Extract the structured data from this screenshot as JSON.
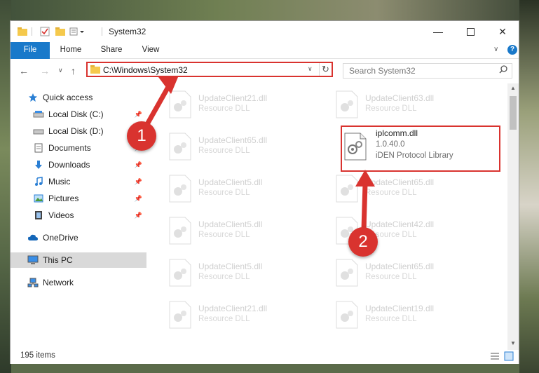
{
  "window": {
    "title": "System32",
    "minimize_icon": "minimize-icon",
    "maximize_icon": "maximize-icon",
    "close_icon": "close-icon"
  },
  "ribbon": {
    "tabs": [
      "File",
      "Home",
      "Share",
      "View"
    ]
  },
  "address": {
    "path": "C:\\Windows\\System32",
    "search_placeholder": "Search System32"
  },
  "sidebar": {
    "items": [
      {
        "label": "Quick access",
        "icon": "star-icon",
        "pinned": false
      },
      {
        "label": "Local Disk (C:)",
        "icon": "drive-icon",
        "pinned": true
      },
      {
        "label": "Local Disk (D:)",
        "icon": "drive-icon",
        "pinned": false
      },
      {
        "label": "Documents",
        "icon": "document-icon",
        "pinned": true
      },
      {
        "label": "Downloads",
        "icon": "download-icon",
        "pinned": true
      },
      {
        "label": "Music",
        "icon": "music-icon",
        "pinned": true
      },
      {
        "label": "Pictures",
        "icon": "pictures-icon",
        "pinned": true
      },
      {
        "label": "Videos",
        "icon": "videos-icon",
        "pinned": true
      },
      {
        "label": "OneDrive",
        "icon": "cloud-icon",
        "pinned": false
      },
      {
        "label": "This PC",
        "icon": "computer-icon",
        "pinned": false
      },
      {
        "label": "Network",
        "icon": "network-icon",
        "pinned": false
      }
    ]
  },
  "files": [
    {
      "name": "UpdateClient21.dll",
      "desc": "Resource DLL"
    },
    {
      "name": "UpdateClient63.dll",
      "desc": "Resource DLL"
    },
    {
      "name": "UpdateClient65.dll",
      "desc": "Resource DLL"
    },
    {
      "name": "iplcomm.dll",
      "version": "1.0.40.0",
      "desc": "iDEN Protocol Library"
    },
    {
      "name": "UpdateClient5.dll",
      "desc": "Resource DLL"
    },
    {
      "name": "UpdateClient65.dll",
      "desc": "Resource DLL"
    },
    {
      "name": "UpdateClient5.dll",
      "desc": "Resource DLL"
    },
    {
      "name": "UpdateClient42.dll",
      "desc": "Resource DLL"
    },
    {
      "name": "UpdateClient5.dll",
      "desc": "Resource DLL"
    },
    {
      "name": "UpdateClient65.dll",
      "desc": "Resource DLL"
    },
    {
      "name": "UpdateClient21.dll",
      "desc": "Resource DLL"
    },
    {
      "name": "UpdateClient19.dll",
      "desc": "Resource DLL"
    }
  ],
  "status": {
    "count": "195 items"
  },
  "annotations": {
    "step1": "1",
    "step2": "2",
    "color": "#d9332f"
  }
}
